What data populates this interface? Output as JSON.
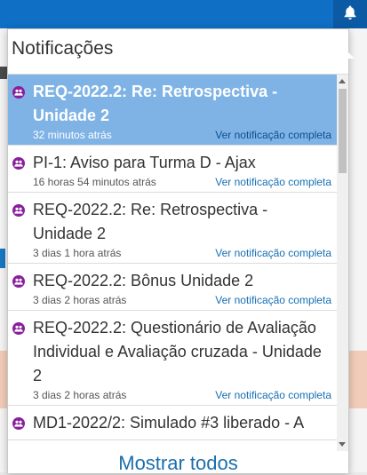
{
  "colors": {
    "accent": "#0f6fc5",
    "selected": "#7fb3e5",
    "icon": "#8a1f9e",
    "link": "#1670b5"
  },
  "header": {
    "bell_icon": "bell-icon"
  },
  "popover": {
    "title": "Notificações",
    "footer": "Mostrar todos"
  },
  "notifications": [
    {
      "subject": "REQ-2022.2: Re: Retrospectiva - Unidade 2",
      "time": "32 minutos atrás",
      "view": "Ver notificação completa",
      "selected": true
    },
    {
      "subject": "PI-1: Aviso para Turma D - Ajax",
      "time": "16 horas 54 minutos atrás",
      "view": "Ver notificação completa"
    },
    {
      "subject": "REQ-2022.2: Re: Retrospectiva - Unidade 2",
      "time": "3 dias 1 hora atrás",
      "view": "Ver notificação completa"
    },
    {
      "subject": "REQ-2022.2: Bônus Unidade 2",
      "time": "3 dias 2 horas atrás",
      "view": "Ver notificação completa"
    },
    {
      "subject": "REQ-2022.2: Questionário de Avaliação Individual e Avaliação cruzada - Unidade 2",
      "time": "3 dias 2 horas atrás",
      "view": "Ver notificação completa"
    },
    {
      "subject": "MD1-2022/2: Simulado #3 liberado - A",
      "time": "",
      "view": ""
    }
  ]
}
